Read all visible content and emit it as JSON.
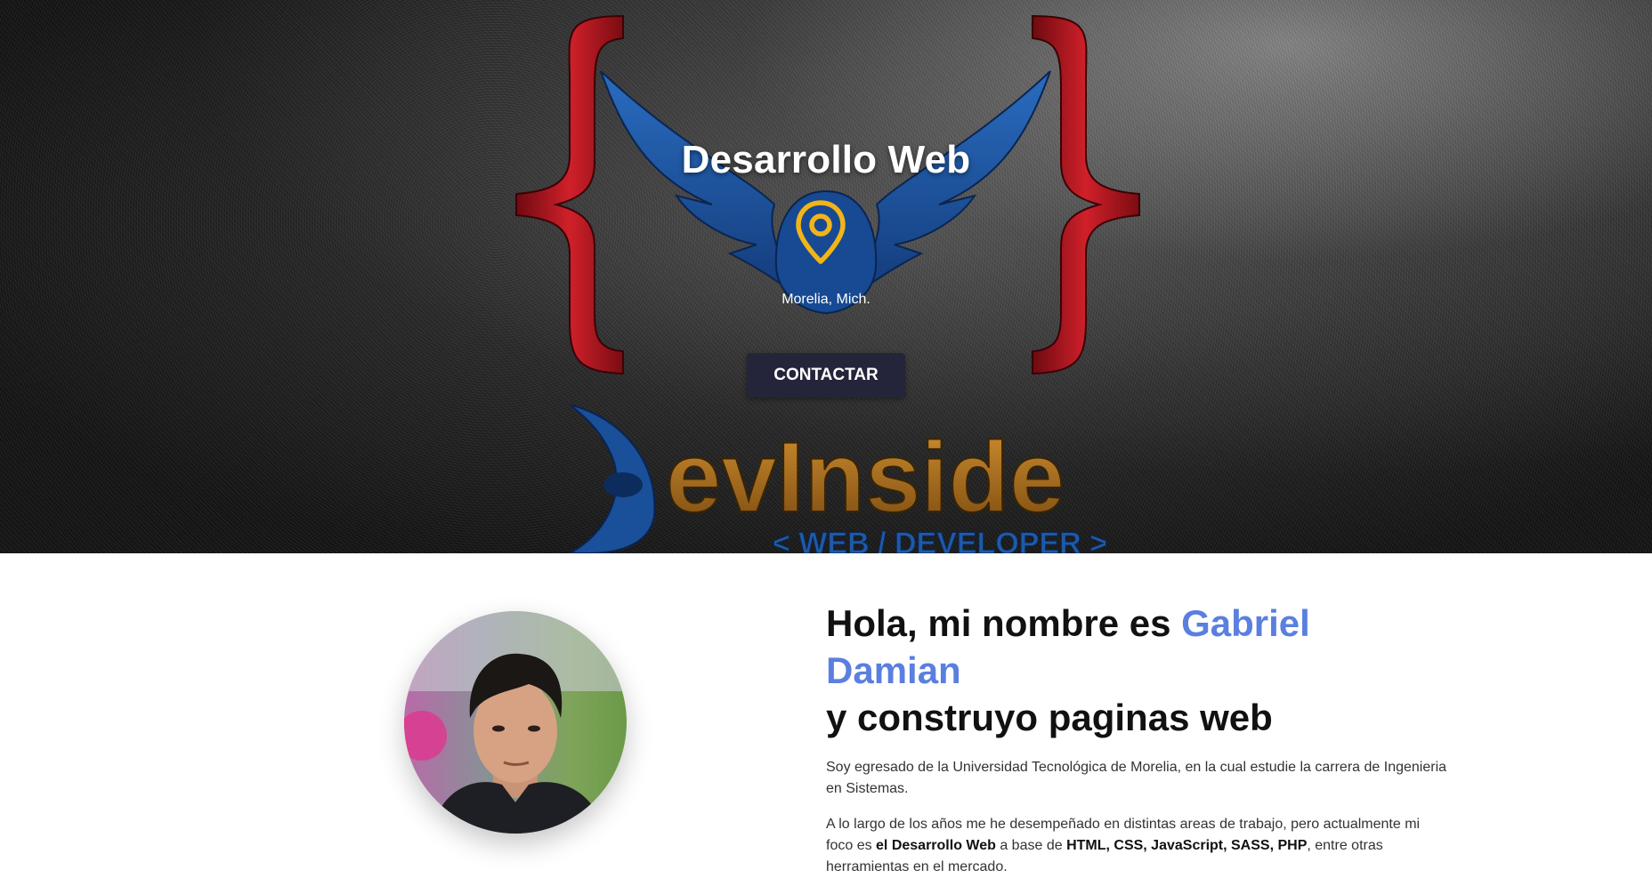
{
  "hero": {
    "title": "Desarrollo Web",
    "location_icon": "map-pin-icon",
    "location": "Morelia, Mich.",
    "contact_label": "CONTACTAR",
    "logo_text": "evInside",
    "logo_tagline": "< WEB / DEVELOPER >",
    "colors": {
      "pin": "#f2b418",
      "button": "#24243a",
      "brace": "#c0141e",
      "wing": "#1f5aa6",
      "logo_text": "#b87a24"
    }
  },
  "about": {
    "heading_pre": "Hola, mi nombre es ",
    "heading_name": "Gabriel Damian",
    "heading_post": "y construyo paginas web",
    "paragraph1": "Soy egresado de la Universidad Tecnológica de Morelia, en la cual estudie la carrera de Ingenieria en Sistemas.",
    "p2_a": "A lo largo de los años me he desempeñado en distintas areas de trabajo, pero actualmente mi foco es ",
    "p2_b": "el Desarrollo Web",
    "p2_c": " a base de ",
    "p2_d": "HTML, CSS, JavaScript, SASS, PHP",
    "p2_e": ", entre otras herramientas en el mercado.",
    "colors": {
      "name": "#5b7fe0"
    }
  }
}
